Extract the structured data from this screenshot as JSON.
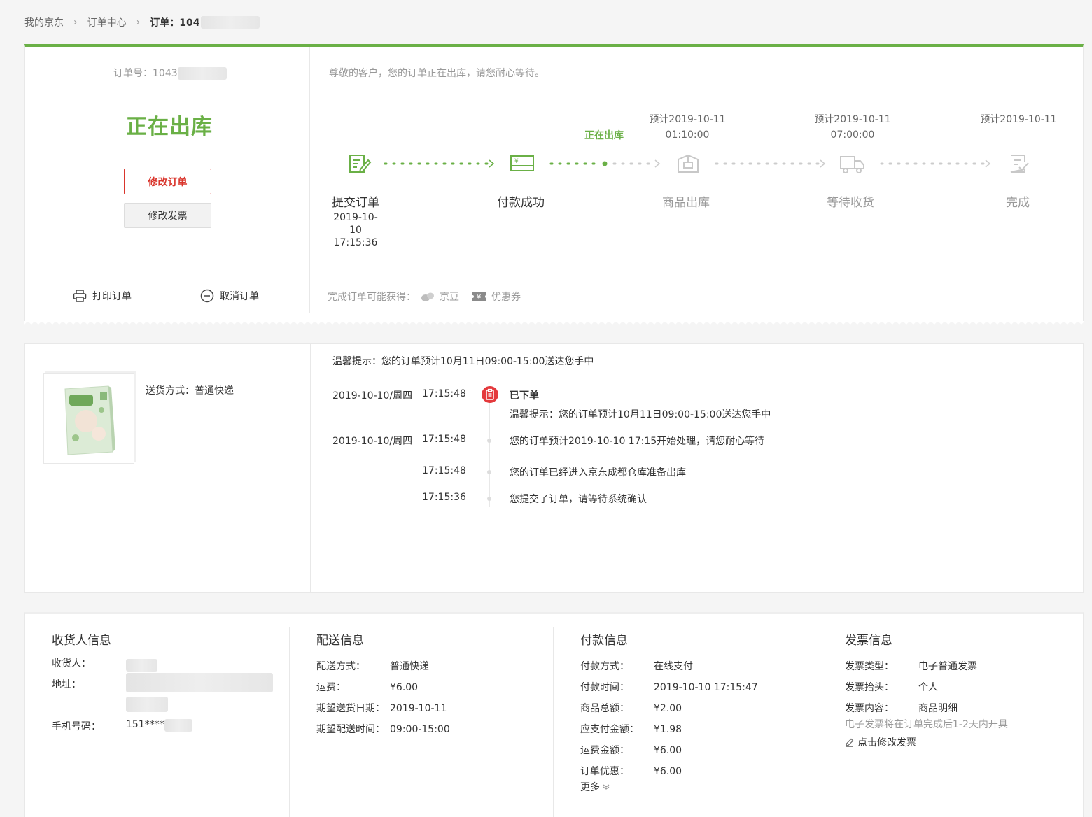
{
  "breadcrumb": {
    "home": "我的京东",
    "center": "订单中心",
    "current_prefix": "订单：104"
  },
  "order": {
    "number_label": "订单号：",
    "number_visible": "1043",
    "status": "正在出库",
    "modify_order": "修改订单",
    "modify_invoice": "修改发票",
    "print": "打印订单",
    "cancel": "取消订单",
    "notice": "尊敬的客户，您的订单正在出库，请您耐心等待。"
  },
  "progress": {
    "current_tag": "正在出库",
    "steps": [
      {
        "label": "提交订单",
        "date": "2019-10-10",
        "time": "17:15:36",
        "icon": "submit-order-icon"
      },
      {
        "label": "付款成功",
        "icon": "payment-card-icon"
      },
      {
        "label": "商品出库",
        "est": "预计2019-10-11",
        "est_time": "01:10:00",
        "icon": "package-icon"
      },
      {
        "label": "等待收货",
        "est": "预计2019-10-11",
        "est_time": "07:00:00",
        "icon": "truck-icon"
      },
      {
        "label": "完成",
        "est": "预计2019-10-11",
        "icon": "complete-icon"
      }
    ],
    "active_color": "#6ab046",
    "inactive_color": "#cccccc"
  },
  "bonus": {
    "label": "完成订单可能获得：",
    "jingdou": "京豆",
    "coupon": "优惠券"
  },
  "shipment": {
    "method_label": "送货方式：",
    "method": "普通快递",
    "tip": "温馨提示：您的订单预计10月11日09:00-15:00送达您手中",
    "timeline": [
      {
        "date": "2019-10-10/周四",
        "time": "17:15:48",
        "title": "已下单",
        "text": "温馨提示：您的订单预计10月11日09:00-15:00送达您手中"
      },
      {
        "date": "2019-10-10/周四",
        "time": "17:15:48",
        "text": "您的订单预计2019-10-10 17:15开始处理，请您耐心等待"
      },
      {
        "date": "",
        "time": "17:15:48",
        "text": "您的订单已经进入京东成都仓库准备出库"
      },
      {
        "date": "",
        "time": "17:15:36",
        "text": "您提交了订单，请等待系统确认"
      }
    ]
  },
  "receiver": {
    "title": "收货人信息",
    "name_label": "收货人：",
    "address_label": "地址：",
    "phone_label": "手机号码：",
    "phone_visible": "151****"
  },
  "delivery": {
    "title": "配送信息",
    "rows": [
      {
        "k": "配送方式：",
        "v": "普通快递"
      },
      {
        "k": "运费：",
        "v": "¥6.00"
      },
      {
        "k": "期望送货日期：",
        "v": "2019-10-11"
      },
      {
        "k": "期望配送时间：",
        "v": "09:00-15:00"
      }
    ]
  },
  "payment": {
    "title": "付款信息",
    "rows": [
      {
        "k": "付款方式：",
        "v": "在线支付"
      },
      {
        "k": "付款时间：",
        "v": "2019-10-10 17:15:47"
      },
      {
        "k": "商品总额：",
        "v": "¥2.00"
      },
      {
        "k": "应支付金额：",
        "v": "¥1.98"
      },
      {
        "k": "运费金额：",
        "v": "¥6.00"
      },
      {
        "k": "订单优惠：",
        "v": "¥6.00"
      }
    ],
    "more": "更多"
  },
  "invoice": {
    "title": "发票信息",
    "rows": [
      {
        "k": "发票类型：",
        "v": "电子普通发票"
      },
      {
        "k": "发票抬头：",
        "v": "个人"
      },
      {
        "k": "发票内容：",
        "v": "商品明细"
      }
    ],
    "note": "电子发票将在订单完成后1-2天内开具",
    "edit": "点击修改发票"
  }
}
